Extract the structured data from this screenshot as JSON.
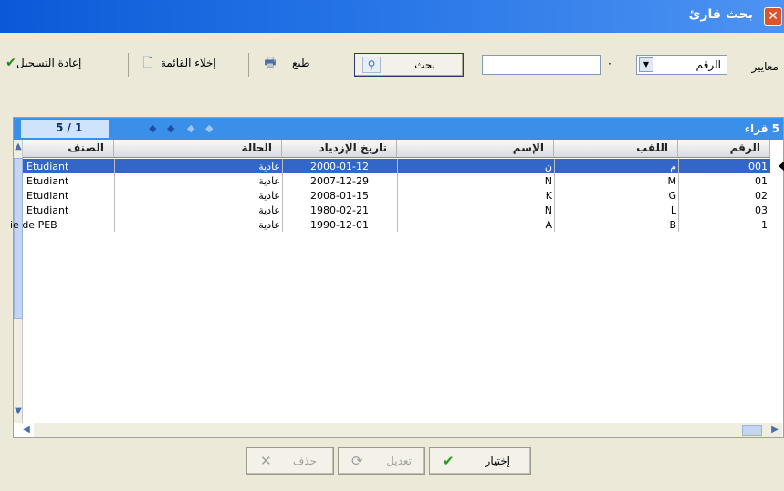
{
  "window": {
    "title": "بحث قارئ"
  },
  "toolbar": {
    "criteria_label": "معايير",
    "criteria_select": "الرقم",
    "search_value": "",
    "search_button": "بحث",
    "print_label": "طبع",
    "clear_list_label": "إخلاء القائمة",
    "reset_label": "إعادة التسجيل"
  },
  "grid": {
    "count_label": "5 قراء",
    "page_label": "5 / 1",
    "columns": [
      "الرقم",
      "اللقب",
      "الإسم",
      "تاريخ الإزدياد",
      "الحالة",
      "الصنف"
    ],
    "rows": [
      {
        "num": "001",
        "lastname": "م",
        "firstname": "ن",
        "dob": "2000-01-12",
        "status": "عادية",
        "category": "Etudiant"
      },
      {
        "num": "01",
        "lastname": "M",
        "firstname": "N",
        "dob": "2007-12-29",
        "status": "عادية",
        "category": "Etudiant"
      },
      {
        "num": "02",
        "lastname": "G",
        "firstname": "K",
        "dob": "2008-01-15",
        "status": "عادية",
        "category": "Etudiant"
      },
      {
        "num": "03",
        "lastname": "L",
        "firstname": "N",
        "dob": "1980-02-21",
        "status": "عادية",
        "category": "Etudiant"
      },
      {
        "num": "1",
        "lastname": "B",
        "firstname": "A",
        "dob": "1990-12-01",
        "status": "عادية",
        "category": "ie de PEB"
      }
    ],
    "selected_row": 0
  },
  "buttons": {
    "choose": "إختيار",
    "edit": "تعديل",
    "delete": "حذف"
  },
  "colors": {
    "title_bar": "#0a5ad8",
    "grid_header": "#3a8fe8",
    "selection": "#3466c8",
    "check_green": "#2a9a1a"
  }
}
